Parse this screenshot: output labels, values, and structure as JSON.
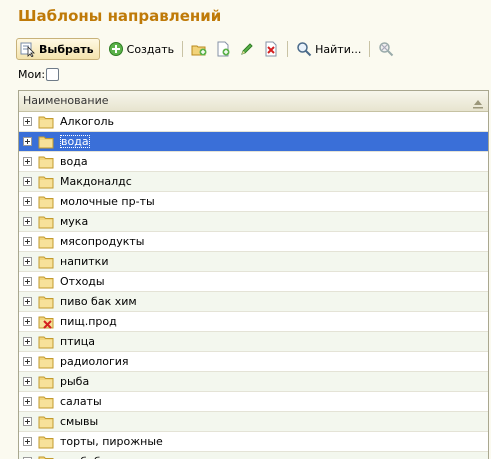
{
  "title": "Шаблоны направлений",
  "toolbar": {
    "select_label": "Выбрать",
    "create_label": "Создать",
    "find_label": "Найти..."
  },
  "filter": {
    "mine_label": "Мои:"
  },
  "grid": {
    "column_header": "Наименование",
    "rows": [
      {
        "label": "Алкоголь"
      },
      {
        "label": "вода"
      },
      {
        "label": "вода"
      },
      {
        "label": "Макдоналдс"
      },
      {
        "label": "молочные пр-ты"
      },
      {
        "label": "мука"
      },
      {
        "label": "мясопродукты"
      },
      {
        "label": "напитки"
      },
      {
        "label": "Отходы"
      },
      {
        "label": "пиво бак хим"
      },
      {
        "label": "пищ.прод"
      },
      {
        "label": "птица"
      },
      {
        "label": "радиология"
      },
      {
        "label": "рыба"
      },
      {
        "label": "салаты"
      },
      {
        "label": "смывы"
      },
      {
        "label": "торты, пирожные"
      },
      {
        "label": "хлебобулоч., пироги"
      }
    ]
  },
  "colors": {
    "title": "#bf7a08",
    "selection": "#3a6fd8"
  }
}
